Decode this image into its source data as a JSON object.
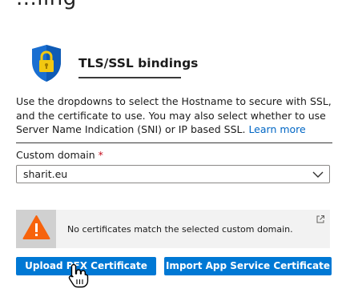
{
  "header": {
    "partial_title": "...ling"
  },
  "bindings": {
    "title": "TLS/SSL bindings",
    "description": "Use the dropdowns to select the Hostname to secure with SSL, and the certificate to use. You may also select whether to use Server Name Indication (SNI) or IP based SSL.",
    "learn_more": "Learn more"
  },
  "custom_domain": {
    "label": "Custom domain",
    "required_mark": "*",
    "selected": "sharit.eu"
  },
  "alert": {
    "message": "No certificates match the selected custom domain."
  },
  "actions": {
    "upload_label": "Upload PFX Certificate",
    "import_label": "Import App Service Certificate"
  },
  "icons": {
    "shield": "shield-lock-icon",
    "warning": "warning-icon",
    "external": "external-link-icon",
    "chevron": "chevron-down-icon",
    "cursor": "hand-pointer-icon"
  },
  "colors": {
    "accent": "#0078d4",
    "link": "#0066c4",
    "warning": "#f7630c",
    "required": "#c50f1f"
  }
}
